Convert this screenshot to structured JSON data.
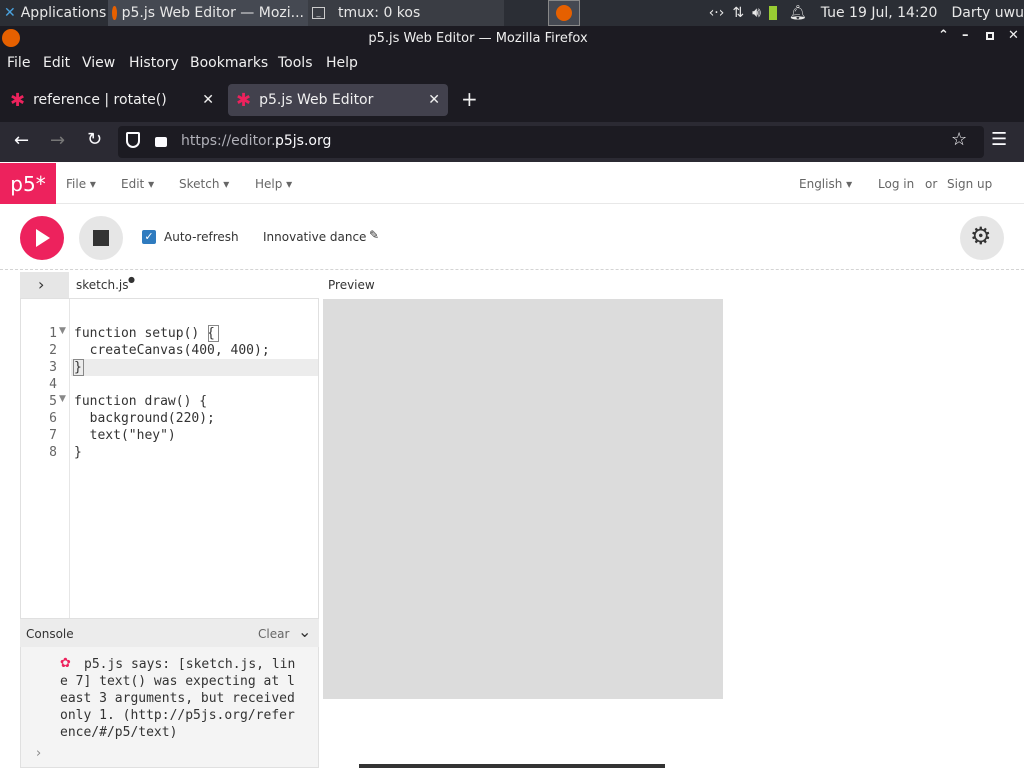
{
  "taskbar": {
    "apps_label": "Applications",
    "task1": "p5.js Web Editor — Mozi...",
    "task2": "tmux: 0 kos",
    "datetime": "Tue 19 Jul, 14:20",
    "user": "Darty uwu"
  },
  "window": {
    "title": "p5.js Web Editor — Mozilla Firefox"
  },
  "firefox_menu": [
    "File",
    "Edit",
    "View",
    "History",
    "Bookmarks",
    "Tools",
    "Help"
  ],
  "tabs": [
    {
      "label": "reference | rotate()"
    },
    {
      "label": "p5.js Web Editor"
    }
  ],
  "url": {
    "prefix": "https://editor.",
    "domain": "p5js.org"
  },
  "p5nav": {
    "logo": "p5*",
    "menu": [
      "File",
      "Edit",
      "Sketch",
      "Help"
    ],
    "language": "English",
    "login": "Log in",
    "or": "or",
    "signup": "Sign up"
  },
  "toolbar": {
    "auto_refresh_label": "Auto-refresh",
    "auto_refresh_checked": true,
    "sketch_name": "Innovative dance"
  },
  "editor": {
    "file_name": "sketch.js",
    "preview_label": "Preview",
    "lines": [
      "function setup() {",
      "  createCanvas(400, 400);",
      "}",
      "",
      "function draw() {",
      "  background(220);",
      "  text(\"hey\")",
      "}"
    ]
  },
  "console": {
    "title": "Console",
    "clear": "Clear",
    "message": "p5.js says: [sketch.js, line 7] text() was expecting at least 3 arguments, but received only 1. (http://p5js.org/reference/#/p5/text)",
    "prompt": "›"
  },
  "colors": {
    "accent": "#ed225d",
    "preview_bg": "#dcdcdc"
  }
}
